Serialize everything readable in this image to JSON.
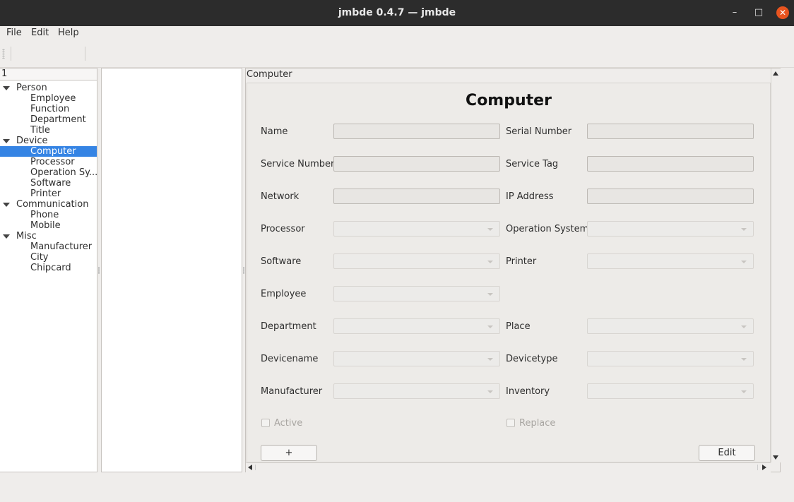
{
  "window": {
    "title": "jmbde 0.4.7 — jmbde",
    "min": "–",
    "max": "□",
    "close": "✕"
  },
  "menubar": {
    "file": "File",
    "edit": "Edit",
    "help": "Help"
  },
  "tree": {
    "header": "1",
    "nodes": [
      {
        "label": "Person",
        "level": 0,
        "expanded": true
      },
      {
        "label": "Employee",
        "level": 1
      },
      {
        "label": "Function",
        "level": 1
      },
      {
        "label": "Department",
        "level": 1
      },
      {
        "label": "Title",
        "level": 1
      },
      {
        "label": "Device",
        "level": 0,
        "expanded": true
      },
      {
        "label": "Computer",
        "level": 1,
        "selected": true
      },
      {
        "label": "Processor",
        "level": 1
      },
      {
        "label": "Operation Sy...",
        "level": 1
      },
      {
        "label": "Software",
        "level": 1
      },
      {
        "label": "Printer",
        "level": 1
      },
      {
        "label": "Communication",
        "level": 0,
        "expanded": true
      },
      {
        "label": "Phone",
        "level": 1
      },
      {
        "label": "Mobile",
        "level": 1
      },
      {
        "label": "Misc",
        "level": 0,
        "expanded": true
      },
      {
        "label": "Manufacturer",
        "level": 1
      },
      {
        "label": "City",
        "level": 1
      },
      {
        "label": "Chipcard",
        "level": 1
      }
    ]
  },
  "form": {
    "tab_label": "Computer",
    "title": "Computer",
    "labels": {
      "name": "Name",
      "serial_number": "Serial Number",
      "service_number": "Service Number",
      "service_tag": "Service Tag",
      "network": "Network",
      "ip_address": "IP Address",
      "processor": "Processor",
      "operation_system": "Operation System",
      "software": "Software",
      "printer": "Printer",
      "employee": "Employee",
      "department": "Department",
      "place": "Place",
      "devicename": "Devicename",
      "devicetype": "Devicetype",
      "manufacturer": "Manufacturer",
      "inventory": "Inventory"
    },
    "values": {
      "name": "",
      "serial_number": "",
      "service_number": "",
      "service_tag": "",
      "network": "",
      "ip_address": ""
    },
    "checkboxes": {
      "active": "Active",
      "replace": "Replace"
    },
    "buttons": {
      "add": "+",
      "edit": "Edit"
    }
  },
  "colors": {
    "selection": "#3584e4",
    "close_button": "#e9541f",
    "titlebar": "#2c2c2c"
  }
}
